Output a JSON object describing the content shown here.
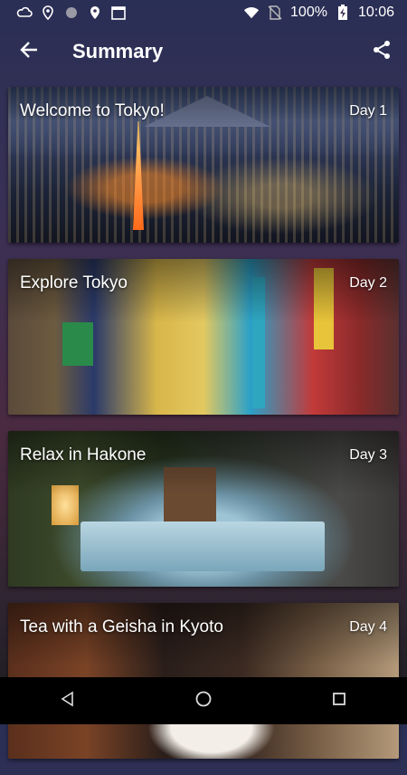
{
  "status_bar": {
    "left_icons": [
      "cloud-notification-icon",
      "location-pin-icon",
      "circle-notification-icon",
      "location-pin-icon",
      "calendar-icon"
    ],
    "right_icons": [
      "wifi-icon",
      "no-sim-icon",
      "battery-charging-icon"
    ],
    "battery": "100%",
    "time": "10:06"
  },
  "toolbar": {
    "title": "Summary",
    "back_icon": "back-arrow-icon",
    "share_icon": "share-icon"
  },
  "days": [
    {
      "title": "Welcome to Tokyo!",
      "day": "Day 1",
      "image": "tokyo-night-skyline"
    },
    {
      "title": "Explore Tokyo",
      "day": "Day 2",
      "image": "tokyo-street-signs"
    },
    {
      "title": "Relax in Hakone",
      "day": "Day 3",
      "image": "hakone-onsen-bath"
    },
    {
      "title": "Tea with a Geisha in Kyoto",
      "day": "Day 4",
      "image": "kyoto-geisha"
    }
  ],
  "nav_bar": {
    "icons": [
      "back-triangle-icon",
      "home-circle-icon",
      "recents-square-icon"
    ]
  },
  "colors": {
    "background": "#3a3055",
    "nav_bar": "#000000",
    "text": "#ffffff"
  }
}
